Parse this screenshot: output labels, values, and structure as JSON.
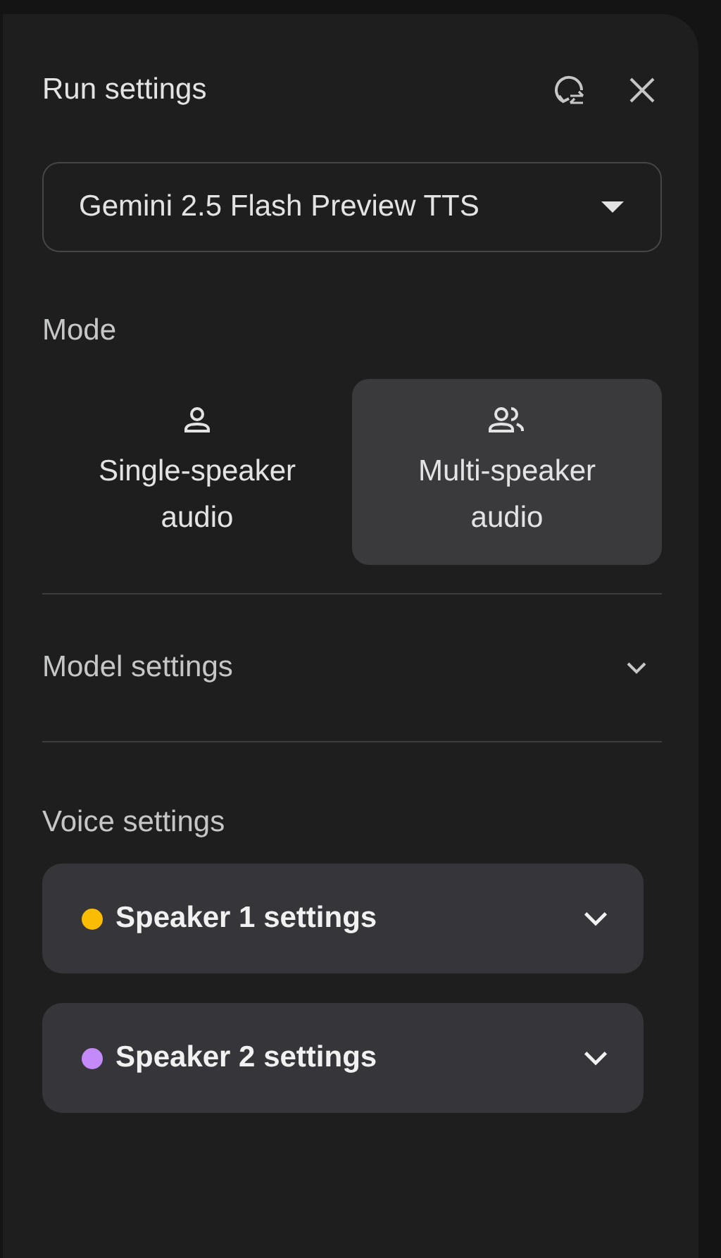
{
  "panel": {
    "title": "Run settings"
  },
  "model_select": {
    "value": "Gemini 2.5 Flash Preview TTS"
  },
  "mode": {
    "label": "Mode",
    "options": [
      {
        "kind": "single",
        "label": "Single-speaker audio",
        "selected": false
      },
      {
        "kind": "multi",
        "label": "Multi-speaker audio",
        "selected": true
      }
    ]
  },
  "model_settings": {
    "label": "Model settings",
    "expanded": false
  },
  "voice_settings": {
    "label": "Voice settings",
    "speakers": [
      {
        "label": "Speaker 1 settings",
        "color": "#fbbc04",
        "expanded": false
      },
      {
        "label": "Speaker 2 settings",
        "color": "#c58af9",
        "expanded": false
      }
    ]
  }
}
